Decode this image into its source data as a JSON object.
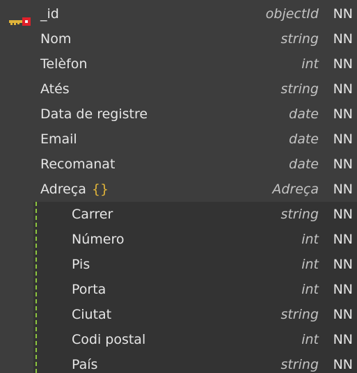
{
  "fields": [
    {
      "name": "_id",
      "type": "objectId",
      "nn": "NN"
    },
    {
      "name": "Nom",
      "type": "string",
      "nn": "NN"
    },
    {
      "name": "Telèfon",
      "type": "int",
      "nn": "NN"
    },
    {
      "name": "Atés",
      "type": "string",
      "nn": "NN"
    },
    {
      "name": "Data de registre",
      "type": "date",
      "nn": "NN"
    },
    {
      "name": "Email",
      "type": "date",
      "nn": "NN"
    },
    {
      "name": "Recomanat",
      "type": "date",
      "nn": "NN"
    },
    {
      "name": "Adreça",
      "braces": "{}",
      "type": "Adreça",
      "nn": "NN"
    }
  ],
  "subfields": [
    {
      "name": "Carrer",
      "type": "string",
      "nn": "NN"
    },
    {
      "name": "Número",
      "type": "int",
      "nn": "NN"
    },
    {
      "name": "Pis",
      "type": "int",
      "nn": "NN"
    },
    {
      "name": "Porta",
      "type": "int",
      "nn": "NN"
    },
    {
      "name": "Ciutat",
      "type": "string",
      "nn": "NN"
    },
    {
      "name": "Codi postal",
      "type": "int",
      "nn": "NN"
    },
    {
      "name": "País",
      "type": "string",
      "nn": "NN"
    }
  ],
  "icons": {
    "primary_key": "key-icon",
    "colors": {
      "key_gold": "#e0b43a",
      "key_red": "#e0202a",
      "braces": "#e0b43a",
      "nested_line": "#8dc63f"
    }
  }
}
